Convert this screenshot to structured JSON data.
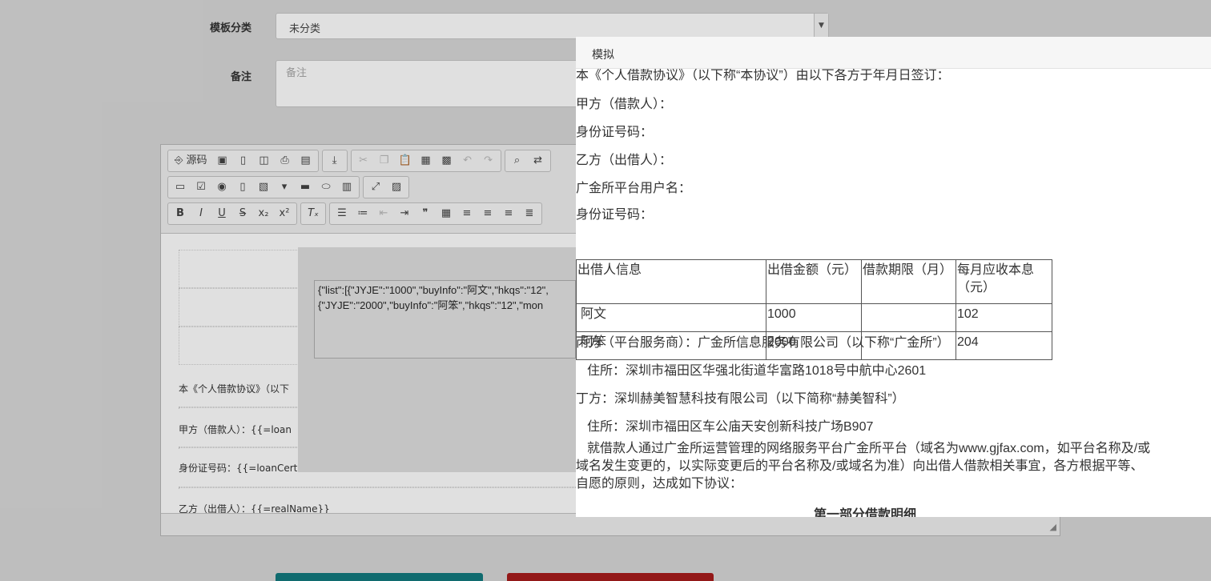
{
  "form": {
    "category_label": "模板分类",
    "category_value": "未分类",
    "note_label": "备注",
    "note_placeholder": "备注"
  },
  "editor": {
    "source_label": "源码",
    "lines": [
      "本《个人借款协议》（以下",
      "甲方（借款人）：{{=loan",
      "身份证号码：{{=loanCert",
      "乙方（出借人）：{{=realName}}"
    ]
  },
  "data_dialog": {
    "text": "{\"list\":[{\"JYJE\":\"1000\",\"buyInfo\":\"阿文\",\"hkqs\":\"12\",\n{\"JYJE\":\"2000\",\"buyInfo\":\"阿笨\",\"hkqs\":\"12\",\"mon"
  },
  "preview": {
    "title": "模拟",
    "intro": "本《个人借款协议》（以下称“本协议”）由以下各方于年月日签订：",
    "party_a": "甲方（借款人）：",
    "id_a": "身份证号码：",
    "party_b": "乙方（出借人）：",
    "platform_user": "广金所平台用户名：",
    "id_b": "身份证号码：",
    "table": {
      "headers": [
        "出借人信息",
        "出借金额（元）",
        "借款期限（月）",
        "每月应收本息（元）"
      ],
      "rows": [
        [
          "阿文",
          "1000",
          "",
          "102"
        ],
        [
          "阿笨",
          "2000",
          "",
          "204"
        ]
      ]
    },
    "party_c": "丙方（平台服务商）：广金所信息服务有限公司（以下称“广金所”）",
    "address_c": "住所：深圳市福田区华强北街道华富路1018号中航中心2601",
    "party_d": "丁方：深圳赫美智慧科技有限公司（以下简称“赫美智科”）",
    "address_d": "住所：深圳市福田区车公庙天安创新科技广场B907",
    "agreement_para": "就借款人通过广金所运营管理的网络服务平台广金所平台（域名为www.gjfax.com，如平台名称及/或域名发生变更的，以实际变更后的平台名称及/或域名为准）向出借人借款相关事宜，各方根据平等、自愿的原则，达成如下协议：",
    "section_title": "第一部分借款明细"
  }
}
